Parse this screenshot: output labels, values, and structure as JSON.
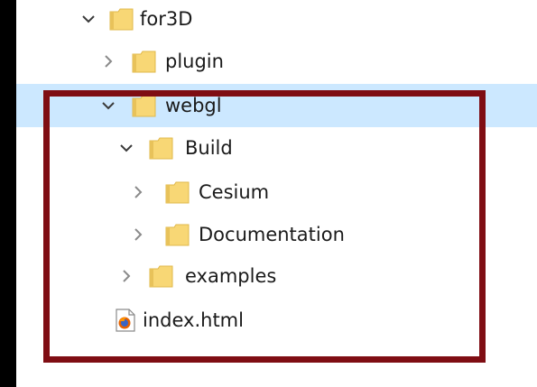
{
  "tree": {
    "items": [
      {
        "label": "for3D",
        "expanded": true,
        "icon": "folder-icon"
      },
      {
        "label": "plugin",
        "expanded": false,
        "icon": "folder-icon"
      },
      {
        "label": "webgl",
        "expanded": true,
        "icon": "folder-icon",
        "selected": true
      },
      {
        "label": "Build",
        "expanded": true,
        "icon": "folder-icon"
      },
      {
        "label": "Cesium",
        "expanded": false,
        "icon": "folder-icon"
      },
      {
        "label": "Documentation",
        "expanded": false,
        "icon": "folder-icon"
      },
      {
        "label": "examples",
        "expanded": false,
        "icon": "folder-icon"
      },
      {
        "label": "index.html",
        "icon": "firefox-html-file-icon"
      }
    ]
  },
  "colors": {
    "selection": "#cce8ff",
    "highlight_frame": "#7f0d13",
    "folder": "#f8d775"
  }
}
